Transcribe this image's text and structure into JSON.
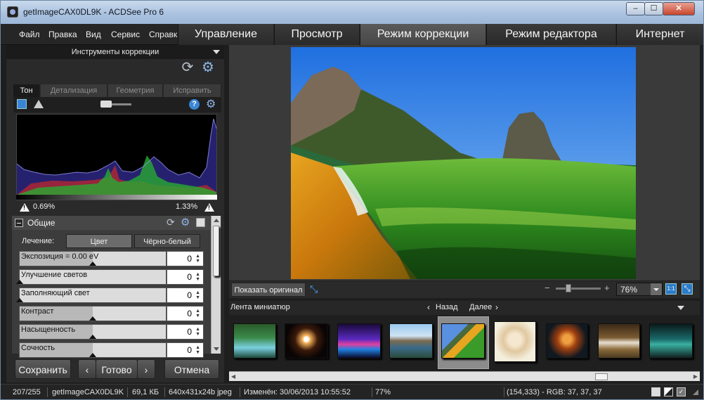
{
  "window": {
    "title": "getImageCAX0DL9K - ACDSee Pro 6",
    "controls": {
      "minimize": "‒",
      "maximize": "☐",
      "close": "✕"
    }
  },
  "menu": [
    "Файл",
    "Правка",
    "Вид",
    "Сервис",
    "Справка"
  ],
  "modes": [
    {
      "label": "Управление",
      "active": false
    },
    {
      "label": "Просмотр",
      "active": false
    },
    {
      "label": "Режим коррекции",
      "active": true
    },
    {
      "label": "Режим редактора",
      "active": false
    },
    {
      "label": "Интернет",
      "active": false
    }
  ],
  "panel": {
    "title": "Инструменты коррекции",
    "tabs": [
      {
        "label": "Тон",
        "active": true
      },
      {
        "label": "Детализация",
        "active": false
      },
      {
        "label": "Геометрия",
        "active": false
      },
      {
        "label": "Исправить",
        "active": false
      }
    ],
    "histogram": {
      "clip_left": "0.69%",
      "clip_right": "1.33%"
    },
    "section_title": "Общие",
    "treatment": {
      "label": "Лечение:",
      "color": "Цвет",
      "bw": "Чёрно-белый",
      "selected": "Цвет"
    },
    "sliders": [
      {
        "label": "Экспозиция = 0.00 eV",
        "value": "0",
        "level": 0.5
      },
      {
        "label": "Улучшение светов",
        "value": "0",
        "level": 0.0
      },
      {
        "label": "Заполняющий свет",
        "value": "0",
        "level": 0.0
      },
      {
        "label": "Контраст",
        "value": "0",
        "level": 0.5
      },
      {
        "label": "Насыщенность",
        "value": "0",
        "level": 0.5
      },
      {
        "label": "Сочность",
        "value": "0",
        "level": 0.5
      }
    ],
    "buttons": {
      "save": "Сохранить",
      "prev": "‹",
      "done": "Готово",
      "next": "›",
      "cancel": "Отмена"
    }
  },
  "viewer": {
    "show_original": "Показать оригинал",
    "zoom": "76%",
    "zoom_minus": "−",
    "zoom_plus": "+",
    "one_to_one": "1:1"
  },
  "filmstrip": {
    "title": "Лента миниатюр",
    "back": "Назад",
    "next": "Далее",
    "thumbnails": [
      "waterfall",
      "eclipse",
      "neon-bridge",
      "mountain-lake",
      "wave-beach",
      "sketch-portrait",
      "fire-portrait",
      "white-horses",
      "vintage-car"
    ],
    "selected_index": 4
  },
  "status": {
    "count": "207/255",
    "filename": "getImageCAX0DL9K",
    "size": "69,1 КБ",
    "dims": "640x431x24b jpeg",
    "modified": "Изменён: 30/06/2013 10:55:52",
    "zoom": "77%",
    "pixel": "(154,333) - RGB: 37, 37, 37"
  },
  "colors": {
    "accent": "#2b7bc7",
    "active_tab": "#4d4d4d",
    "background": "#1e1e1e"
  }
}
